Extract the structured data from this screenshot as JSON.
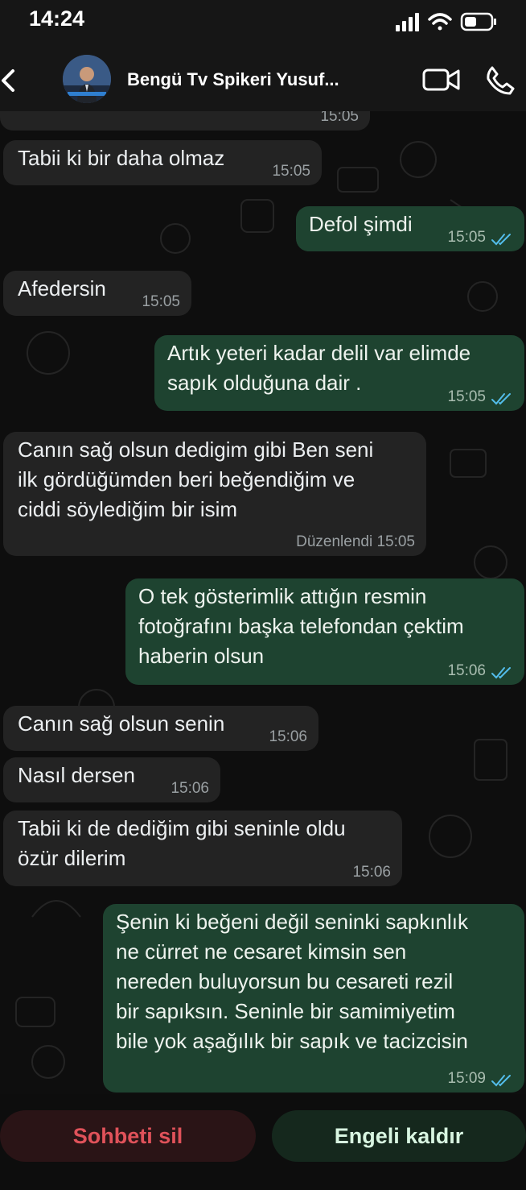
{
  "status_bar": {
    "time": "14:24"
  },
  "header": {
    "contact_name": "Bengü Tv Spikeri Yusuf..."
  },
  "messages": [
    {
      "dir": "in",
      "lines": [],
      "time": "15:05"
    },
    {
      "dir": "in",
      "lines": [
        "Tabii ki bir daha olmaz"
      ],
      "time": "15:05"
    },
    {
      "dir": "out",
      "lines": [
        "Defol şimdi"
      ],
      "time": "15:05"
    },
    {
      "dir": "in",
      "lines": [
        "Afedersin"
      ],
      "time": "15:05"
    },
    {
      "dir": "out",
      "lines": [
        "Artık yeteri kadar delil var elimde",
        "sapık olduğuna dair ."
      ],
      "time": "15:05"
    },
    {
      "dir": "in",
      "lines": [
        "Canın sağ olsun dedigim gibi Ben seni",
        "ilk gördüğümden beri  beğendiğim ve",
        "ciddi söylediğim bir isim"
      ],
      "time": "15:05",
      "edited": "Düzenlendi"
    },
    {
      "dir": "out",
      "lines": [
        "O tek gösterimlik attığın resmin",
        "fotoğrafını başka telefondan çektim",
        "haberin olsun"
      ],
      "time": "15:06"
    },
    {
      "dir": "in",
      "lines": [
        "Canın sağ olsun senin"
      ],
      "time": "15:06"
    },
    {
      "dir": "in",
      "lines": [
        "Nasıl dersen"
      ],
      "time": "15:06"
    },
    {
      "dir": "in",
      "lines": [
        "Tabii ki de dediğim gibi seninle oldu",
        "özür dilerim"
      ],
      "time": "15:06"
    },
    {
      "dir": "out",
      "lines": [
        "Şenin ki beğeni değil seninki sapkınlık",
        "ne cürret ne cesaret kimsin sen",
        "nereden buluyorsun bu cesareti rezil",
        "bir sapıksın. Seninle bir samimiyetim",
        "bile yok aşağılık bir sapık ve tacizcisin"
      ],
      "time": "15:09"
    }
  ],
  "footer": {
    "delete_label": "Sohbeti sil",
    "unblock_label": "Engeli kaldır"
  },
  "colors": {
    "incoming": "#232323",
    "outgoing": "#1e4330",
    "read_ticks": "#53bdeb",
    "delete_text": "#e0525a"
  },
  "icons": [
    "back-chevron-icon",
    "video-call-icon",
    "phone-icon",
    "signal-icon",
    "wifi-icon",
    "battery-icon",
    "read-receipt-icon"
  ]
}
